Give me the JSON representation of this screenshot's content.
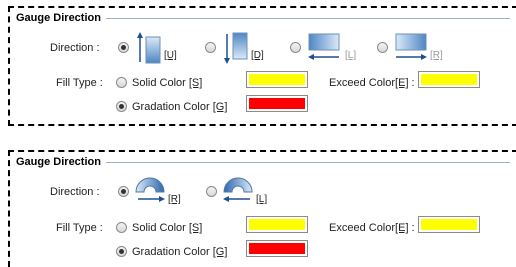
{
  "panels": [
    {
      "title": "Gauge Direction",
      "direction_label": "Direction :",
      "directions": [
        {
          "key": "[U]",
          "selected": true,
          "icon": "vertical-bar-up-icon"
        },
        {
          "key": "[D]",
          "selected": false,
          "icon": "vertical-bar-down-icon"
        },
        {
          "key": "[L]",
          "selected": false,
          "icon": "horizontal-bar-left-icon"
        },
        {
          "key": "[R]",
          "selected": false,
          "icon": "horizontal-bar-right-icon"
        }
      ],
      "fill_type_label": "Fill Type :",
      "solid_label": "Solid Color",
      "solid_key": "[S]",
      "solid_selected": false,
      "gradation_label": "Gradation Color",
      "gradation_key": "[G]",
      "gradation_selected": true,
      "exceed_label": "Exceed Color",
      "exceed_key": "[E]",
      "exceed_suffix": " :",
      "solid_color": "#ffff00",
      "gradation_color": "#ff0000",
      "exceed_color": "#ffff00"
    },
    {
      "title": "Gauge Direction",
      "direction_label": "Direction :",
      "directions": [
        {
          "key": "[R]",
          "selected": true,
          "icon": "arc-gauge-right-icon"
        },
        {
          "key": "[L]",
          "selected": false,
          "icon": "arc-gauge-left-icon"
        }
      ],
      "fill_type_label": "Fill Type :",
      "solid_label": "Solid Color",
      "solid_key": "[S]",
      "solid_selected": false,
      "gradation_label": "Gradation Color",
      "gradation_key": "[G]",
      "gradation_selected": true,
      "exceed_label": "Exceed Color",
      "exceed_key": "[E]",
      "exceed_suffix": " :",
      "solid_color": "#ffff00",
      "gradation_color": "#ff0000",
      "exceed_color": "#ffff00"
    }
  ]
}
